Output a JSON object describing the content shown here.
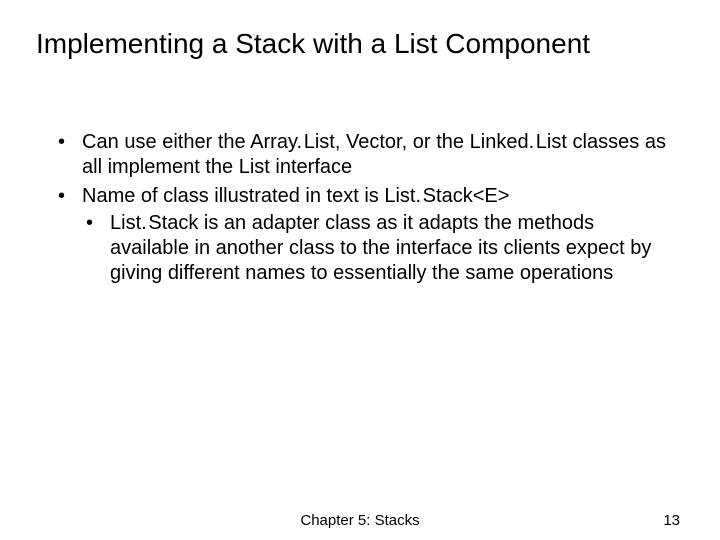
{
  "title": "Implementing a Stack with a List Component",
  "bullets": {
    "b1": "Can use either the Array. List, Vector, or the Linked. List classes as all implement the List interface",
    "b2": "Name of class illustrated in text is List. Stack<E>",
    "b2_1": "List. Stack is an adapter class as it adapts the methods available in another class to the interface its clients expect by giving different names to essentially the same operations"
  },
  "footer": {
    "chapter": "Chapter 5: Stacks",
    "page": "13"
  }
}
